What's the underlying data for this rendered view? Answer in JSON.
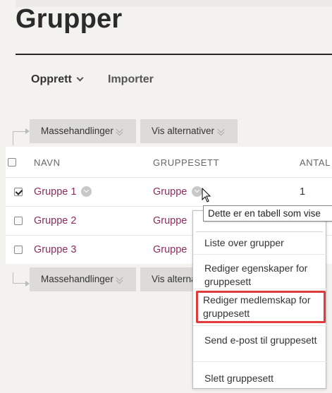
{
  "page": {
    "title": "Grupper"
  },
  "actions": {
    "create_label": "Opprett",
    "import_label": "Importer"
  },
  "toolbar": {
    "mass_actions_label": "Massehandlinger",
    "view_options_label": "Vis alternativer",
    "view_options_label_short": "Vis alterna"
  },
  "table": {
    "headers": [
      "NAVN",
      "GRUPPESETT",
      "ANTAL"
    ],
    "rows": [
      {
        "name": "Gruppe 1",
        "group_set": "Gruppe",
        "count": "1",
        "checked": true
      },
      {
        "name": "Gruppe 2",
        "group_set": "Gruppe",
        "count": "",
        "checked": false
      },
      {
        "name": "Gruppe 3",
        "group_set": "Gruppe",
        "count": "",
        "checked": false
      }
    ]
  },
  "tooltip": {
    "text": "Dette er en tabell som vise"
  },
  "context_menu": {
    "items": [
      "Liste over grupper",
      "Rediger egenskaper for gruppesett",
      "Rediger medlemskap for gruppesett",
      "Send e-post til gruppesett",
      "Slett gruppesett"
    ],
    "highlighted_index": 2
  },
  "colors": {
    "link": "#8a2d5c",
    "highlight_border": "#e03c3c",
    "background": "#f3f2ee"
  }
}
